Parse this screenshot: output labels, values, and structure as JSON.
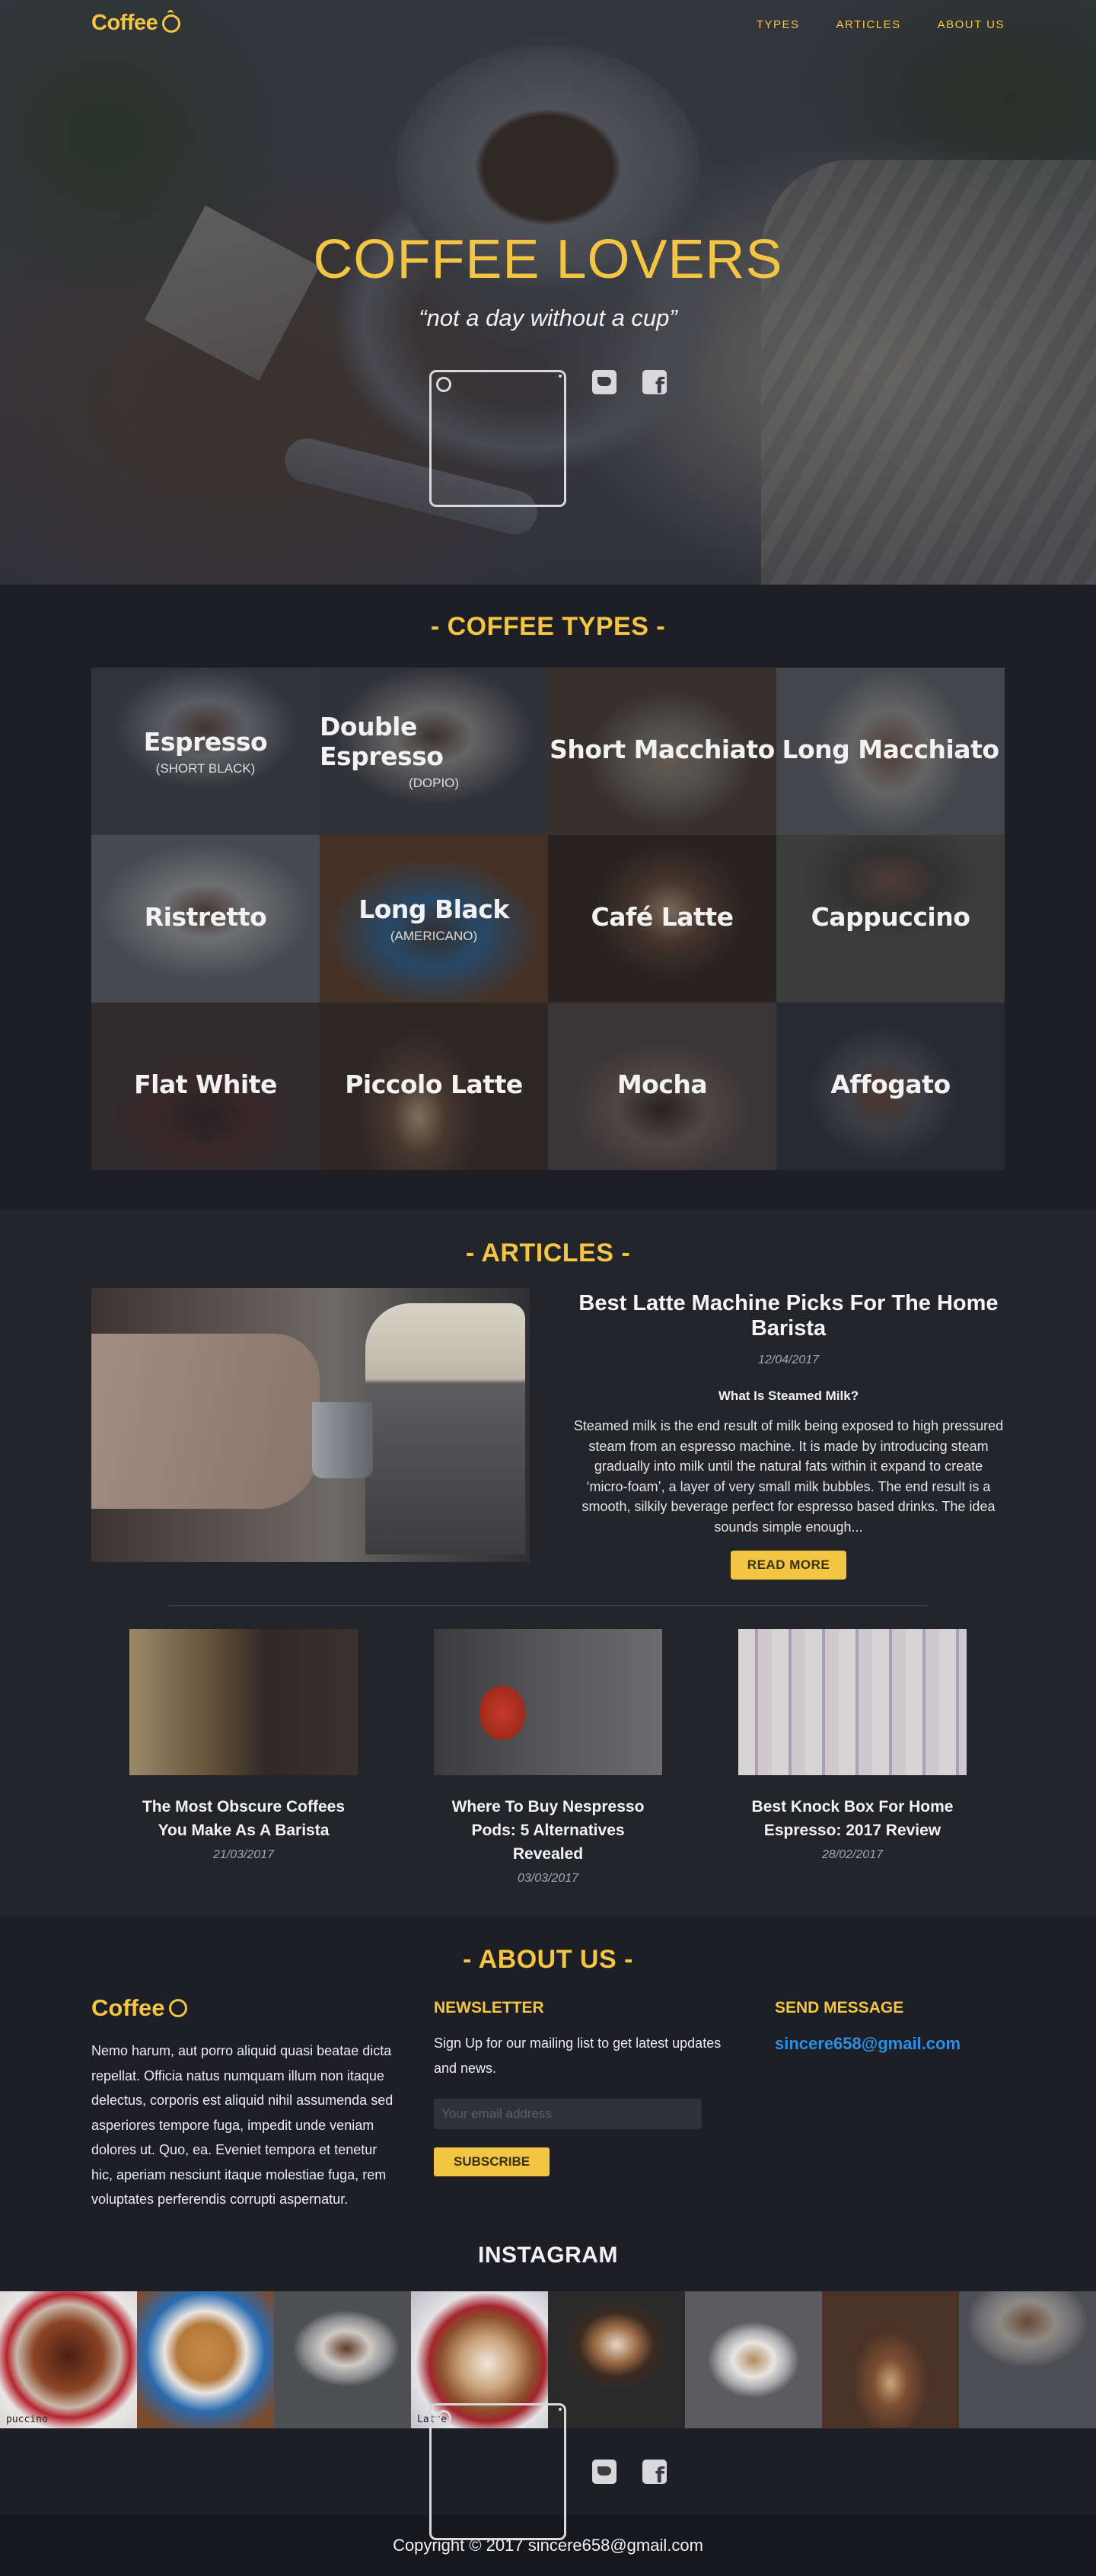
{
  "brand": {
    "logo_text": "Coffee"
  },
  "nav": {
    "links": [
      "TYPES",
      "ARTICLES",
      "ABOUT US"
    ]
  },
  "hero": {
    "title": "COFFEE LOVERS",
    "subtitle": "“not a day without a cup”",
    "social": [
      "instagram-icon",
      "twitter-icon",
      "facebook-icon"
    ]
  },
  "types": {
    "heading": "- COFFEE TYPES -",
    "items": [
      {
        "name": "Espresso",
        "sub": "(SHORT BLACK)"
      },
      {
        "name": "Double Espresso",
        "sub": "(DOPIO)"
      },
      {
        "name": "Short Macchiato",
        "sub": ""
      },
      {
        "name": "Long Macchiato",
        "sub": ""
      },
      {
        "name": "Ristretto",
        "sub": ""
      },
      {
        "name": "Long Black",
        "sub": "(AMERICANO)"
      },
      {
        "name": "Café Latte",
        "sub": ""
      },
      {
        "name": "Cappuccino",
        "sub": ""
      },
      {
        "name": "Flat White",
        "sub": ""
      },
      {
        "name": "Piccolo Latte",
        "sub": ""
      },
      {
        "name": "Mocha",
        "sub": ""
      },
      {
        "name": "Affogato",
        "sub": ""
      }
    ]
  },
  "articles": {
    "heading": "- ARTICLES -",
    "featured": {
      "title": "Best Latte Machine Picks For The Home Barista",
      "date": "12/04/2017",
      "question": "What Is Steamed Milk?",
      "body": "Steamed milk is the end result of milk being exposed to high pressured steam from an espresso machine. It is made by introducing steam gradually into milk until the natural fats within it expand to create ‘micro-foam’, a layer of very small milk bubbles. The end result is a smooth, silkily beverage perfect for espresso based drinks. The idea sounds simple enough...",
      "button": "READ MORE"
    },
    "list": [
      {
        "title": "The Most Obscure Coffees You Make As A Barista",
        "date": "21/03/2017"
      },
      {
        "title": "Where To Buy Nespresso Pods: 5 Alternatives Revealed",
        "date": "03/03/2017"
      },
      {
        "title": "Best Knock Box For Home Espresso: 2017 Review",
        "date": "28/02/2017"
      }
    ]
  },
  "about": {
    "heading": "- ABOUT US -",
    "logo_text": "Coffee",
    "text": "Nemo harum, aut porro aliquid quasi beatae dicta repellat. Officia natus numquam illum non itaque delectus, corporis est aliquid nihil assumenda sed asperiores tempore fuga, impedit unde veniam dolores ut. Quo, ea. Eveniet tempora et tenetur hic, aperiam nesciunt itaque molestiae fuga, rem voluptates perferendis corrupti aspernatur.",
    "newsletter": {
      "heading": "NEWSLETTER",
      "text": "Sign Up for our mailing list to get latest updates and news.",
      "placeholder": "Your email address",
      "button": "SUBSCRIBE"
    },
    "message": {
      "heading": "SEND MESSAGE",
      "email": "sincere658@gmail.com"
    }
  },
  "instagram": {
    "heading": "INSTAGRAM",
    "captions": [
      "puccino",
      "",
      "",
      "Latte",
      "",
      "",
      "",
      ""
    ]
  },
  "footer": {
    "copyright": "Copyright © 2017 sincere658@gmail.com"
  },
  "colors": {
    "accent": "#f4c542",
    "bg": "#1e1f26",
    "bg_alt": "#23252a",
    "link": "#2b8fe3"
  }
}
